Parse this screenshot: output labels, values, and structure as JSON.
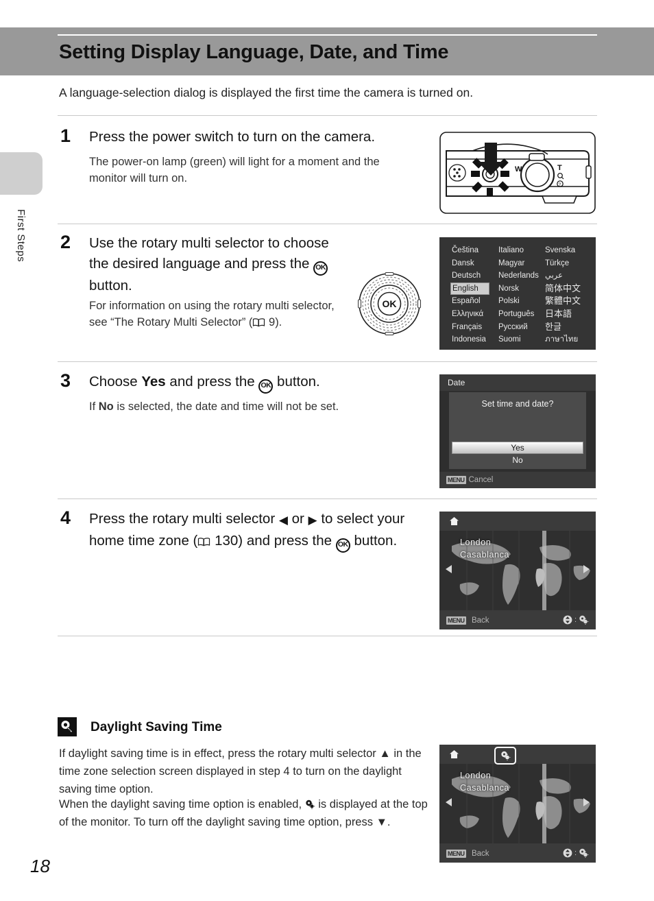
{
  "header": {
    "title": "Setting Display Language, Date, and Time",
    "intro": "A language-selection dialog is displayed the first time the camera is turned on."
  },
  "margin": {
    "section_label": "First Steps",
    "page_number": "18"
  },
  "steps": [
    {
      "number": "1",
      "heading_before": "Press the power switch to turn on the camera.",
      "body": "The power-on lamp (green) will light for a moment and the monitor will turn on."
    },
    {
      "number": "2",
      "heading_a": "Use the rotary multi selector to choose the desired language and press the ",
      "heading_b": " button.",
      "ok_glyph": "OK",
      "body_a": "For information on using the rotary multi selector, see “The Rotary Multi Selector” (",
      "body_page_ref": "9",
      "body_b": ")."
    },
    {
      "number": "3",
      "heading_a": "Choose ",
      "heading_yes": "Yes",
      "heading_b": " and press the ",
      "heading_c": " button.",
      "body_a": "If ",
      "body_no": "No",
      "body_b": " is selected, the date and time will not be set."
    },
    {
      "number": "4",
      "heading_a": "Press the rotary multi selector ",
      "left_arrow": "◀",
      "heading_or": " or ",
      "right_arrow": "▶",
      "heading_b": " to select your home time zone (",
      "page_ref": "130",
      "heading_c": ") and press the ",
      "heading_d": " button."
    }
  ],
  "language_screen": {
    "name": "language-selection-screen",
    "selected": "English",
    "columns": [
      [
        "Čeština",
        "Dansk",
        "Deutsch",
        "English",
        "Español",
        "Ελληνικά",
        "Français",
        "Indonesia"
      ],
      [
        "Italiano",
        "Magyar",
        "Nederlands",
        "Norsk",
        "Polski",
        "Português",
        "Русский",
        "Suomi"
      ],
      [
        "Svenska",
        "Türkçe",
        "عربي",
        "简体中文",
        "繁體中文",
        "日本語",
        "한글",
        "ภาษาไทย"
      ]
    ]
  },
  "date_screen": {
    "title": "Date",
    "message": "Set time and date?",
    "option_yes": "Yes",
    "option_no": "No",
    "footer_badge": "MENU",
    "footer_label": "Cancel"
  },
  "timezone_screen": {
    "city_line1": "London",
    "city_line2": "Casablanca",
    "footer_badge": "MENU",
    "footer_label": "Back",
    "footer_hint_separator": ":",
    "home_icon": "home-icon",
    "dst_icon": "daylight-saving-icon"
  },
  "timezone_screen_dst": {
    "city_line1": "London",
    "city_line2": "Casablanca",
    "footer_badge": "MENU",
    "footer_label": "Back",
    "footer_hint_separator": ":",
    "home_icon": "home-icon",
    "dst_icon": "daylight-saving-icon",
    "dst_badge_active": true
  },
  "tip": {
    "title": "Daylight Saving Time",
    "paragraph1_a": "If daylight saving time is in effect, press the rotary multi selector ",
    "paragraph1_arrow": "▲",
    "paragraph1_b": " in the time zone selection screen displayed in step 4 to turn on the daylight saving time option.",
    "paragraph2_a": "When the daylight saving time option is enabled, ",
    "paragraph2_b": " is displayed at the top of the monitor. To turn off the daylight saving time option, press ",
    "paragraph2_arrow": "▼",
    "paragraph2_c": "."
  }
}
